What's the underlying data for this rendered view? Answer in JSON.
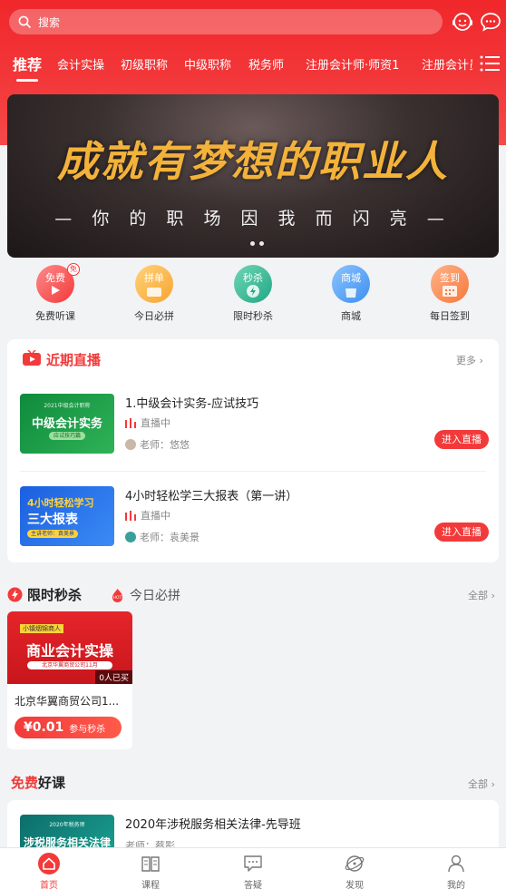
{
  "search": {
    "placeholder": "搜索"
  },
  "tabs": [
    "推荐",
    "会计实操",
    "初级职称",
    "中级职称",
    "税务师",
    "注册会计师·师资1",
    "注册会计员"
  ],
  "banner": {
    "headline": "成就有梦想的职业人",
    "subline": "— 你 的 职 场 因 我 而 闪 亮 —"
  },
  "quick_links": [
    {
      "badge": "免费",
      "label": "免费听课"
    },
    {
      "badge": "拼单",
      "label": "今日必拼"
    },
    {
      "badge": "秒杀",
      "label": "限时秒杀"
    },
    {
      "badge": "商城",
      "label": "商城"
    },
    {
      "badge": "签到",
      "label": "每日签到"
    }
  ],
  "live": {
    "title": "近期直播",
    "more": "更多",
    "items": [
      {
        "title": "1.中级会计实务-应试技巧",
        "status": "直播中",
        "teacher": "老师：悠悠",
        "action": "进入直播",
        "thumb_top": "2021中级会计职称",
        "thumb_main": "中级会计实务",
        "thumb_tag": "应试技巧篇"
      },
      {
        "title": "4小时轻松学三大报表（第一讲）",
        "status": "直播中",
        "teacher": "老师：袁美景",
        "action": "进入直播",
        "thumb_top": "4小时轻松学习",
        "thumb_main": "三大报表",
        "thumb_tag": "主讲老师：袁美景"
      }
    ]
  },
  "flash": {
    "tab_active": "限时秒杀",
    "tab_other": "今日必拼",
    "hot_badge": "HOT",
    "all": "全部",
    "item": {
      "thumb_top": "小镇烟锦商人",
      "thumb_main": "商业会计实操",
      "thumb_sub": "北京华翼商贸公司11月",
      "sold": "0人已买",
      "title": "北京华翼商贸公司1...",
      "price": "¥0.01",
      "action": "参与秒杀"
    }
  },
  "free": {
    "title_red": "免费",
    "title_rest": "好课",
    "all": "全部",
    "item": {
      "title": "2020年涉税服务相关法律-先导班",
      "teacher": "老师：蔡影",
      "thumb_top": "2020年税务师",
      "thumb_main": "涉税服务相关法律"
    }
  },
  "nav": [
    {
      "label": "首页",
      "active": true
    },
    {
      "label": "课程"
    },
    {
      "label": "答疑"
    },
    {
      "label": "发现"
    },
    {
      "label": "我的"
    }
  ]
}
